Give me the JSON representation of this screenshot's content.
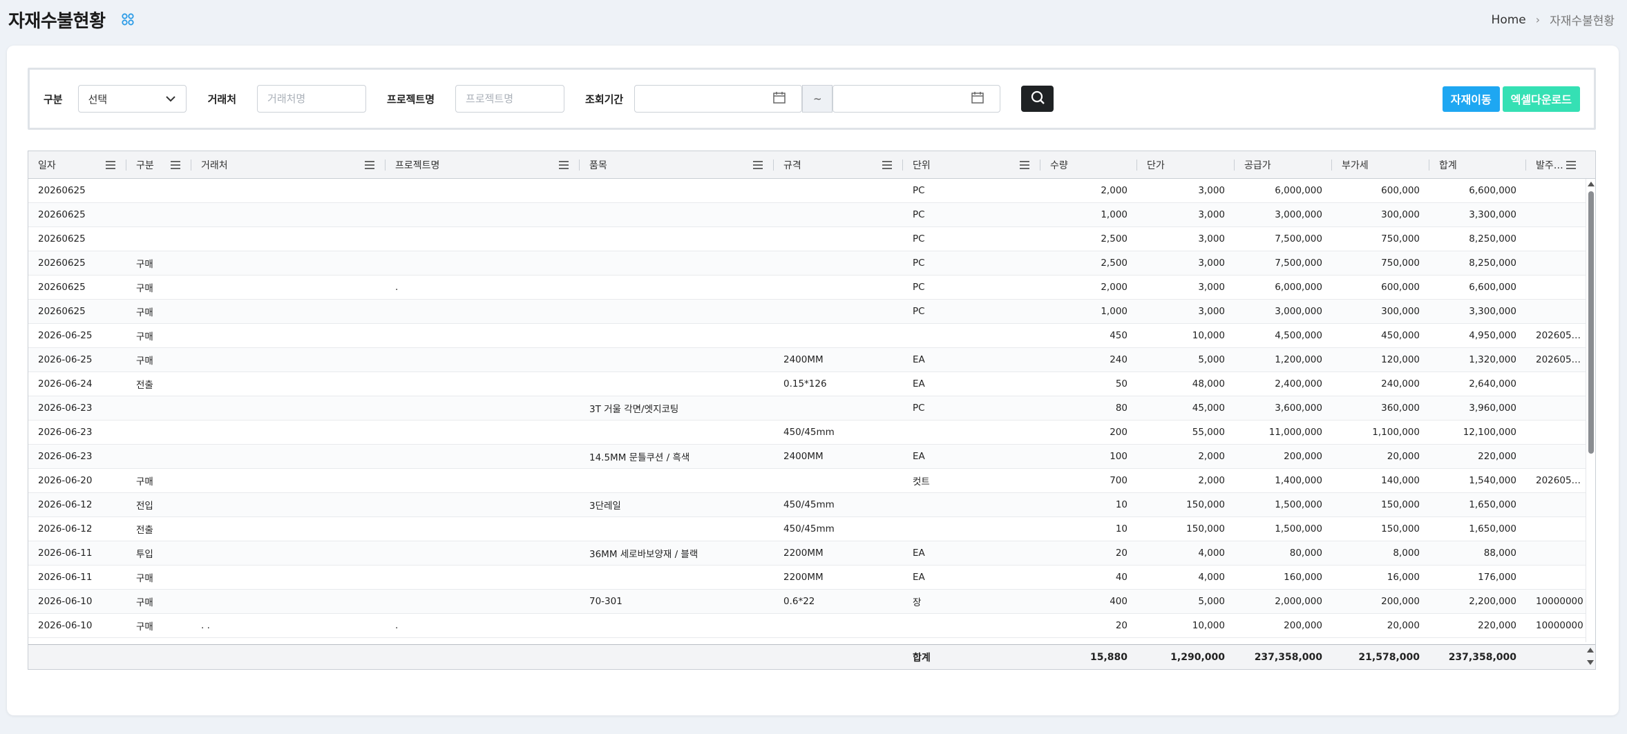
{
  "header": {
    "title": "자재수불현황",
    "breadcrumb": {
      "home": "Home",
      "current": "자재수불현황"
    }
  },
  "filters": {
    "category_label": "구분",
    "category_value": "선택",
    "client_label": "거래처",
    "client_placeholder": "거래처명",
    "project_label": "프로젝트명",
    "project_placeholder": "프로젝트명",
    "period_label": "조회기간",
    "period_separator": "~",
    "move_button": "자재이동",
    "excel_button": "엑셀다운로드"
  },
  "colors": {
    "move_button": "#1ea7f2",
    "excel_button": "#35e0b4",
    "search_button": "#1f2224",
    "title_icon": "#2a9be6"
  },
  "grid": {
    "columns": [
      "일자",
      "구분",
      "거래처",
      "프로젝트명",
      "품목",
      "규격",
      "단위",
      "수량",
      "단가",
      "공급가",
      "부가세",
      "합계",
      "발주…"
    ],
    "rows": [
      [
        "20260625",
        "",
        "",
        "",
        "",
        "",
        "PC",
        "2,000",
        "3,000",
        "6,000,000",
        "600,000",
        "6,600,000",
        ""
      ],
      [
        "20260625",
        "",
        "",
        "",
        "",
        "",
        "PC",
        "1,000",
        "3,000",
        "3,000,000",
        "300,000",
        "3,300,000",
        ""
      ],
      [
        "20260625",
        "",
        "",
        "",
        "",
        "",
        "PC",
        "2,500",
        "3,000",
        "7,500,000",
        "750,000",
        "8,250,000",
        ""
      ],
      [
        "20260625",
        "구매",
        "",
        "",
        "",
        "",
        "PC",
        "2,500",
        "3,000",
        "7,500,000",
        "750,000",
        "8,250,000",
        ""
      ],
      [
        "20260625",
        "구매",
        "",
        ".",
        "",
        "",
        "PC",
        "2,000",
        "3,000",
        "6,000,000",
        "600,000",
        "6,600,000",
        ""
      ],
      [
        "20260625",
        "구매",
        "",
        "",
        "",
        "",
        "PC",
        "1,000",
        "3,000",
        "3,000,000",
        "300,000",
        "3,300,000",
        ""
      ],
      [
        "2026-06-25",
        "구매",
        "",
        "",
        "",
        "",
        "",
        "450",
        "10,000",
        "4,500,000",
        "450,000",
        "4,950,000",
        "202605…"
      ],
      [
        "2026-06-25",
        "구매",
        "",
        "",
        "",
        "2400MM",
        "EA",
        "240",
        "5,000",
        "1,200,000",
        "120,000",
        "1,320,000",
        "202605…"
      ],
      [
        "2026-06-24",
        "전출",
        "",
        "",
        "",
        "0.15*126",
        "EA",
        "50",
        "48,000",
        "2,400,000",
        "240,000",
        "2,640,000",
        ""
      ],
      [
        "2026-06-23",
        "",
        "",
        "",
        "3T 거울 각면/엣지코팅",
        "",
        "PC",
        "80",
        "45,000",
        "3,600,000",
        "360,000",
        "3,960,000",
        ""
      ],
      [
        "2026-06-23",
        "",
        "",
        "",
        "",
        "450/45mm",
        "",
        "200",
        "55,000",
        "11,000,000",
        "1,100,000",
        "12,100,000",
        ""
      ],
      [
        "2026-06-23",
        "",
        "",
        "",
        "14.5MM 문틀쿠션 / 흑색",
        "2400MM",
        "EA",
        "100",
        "2,000",
        "200,000",
        "20,000",
        "220,000",
        ""
      ],
      [
        "2026-06-20",
        "구매",
        "",
        "",
        "",
        "",
        "컷트",
        "700",
        "2,000",
        "1,400,000",
        "140,000",
        "1,540,000",
        "202605…"
      ],
      [
        "2026-06-12",
        "전입",
        "",
        "",
        "3단레일",
        "450/45mm",
        "",
        "10",
        "150,000",
        "1,500,000",
        "150,000",
        "1,650,000",
        ""
      ],
      [
        "2026-06-12",
        "전출",
        "",
        "",
        "",
        "450/45mm",
        "",
        "10",
        "150,000",
        "1,500,000",
        "150,000",
        "1,650,000",
        ""
      ],
      [
        "2026-06-11",
        "투입",
        "",
        "",
        "36MM 세로바보양재 / 블랙",
        "2200MM",
        "EA",
        "20",
        "4,000",
        "80,000",
        "8,000",
        "88,000",
        ""
      ],
      [
        "2026-06-11",
        "구매",
        "",
        "",
        "",
        "2200MM",
        "EA",
        "40",
        "4,000",
        "160,000",
        "16,000",
        "176,000",
        ""
      ],
      [
        "2026-06-10",
        "구매",
        "",
        "",
        "70-301",
        "0.6*22",
        "장",
        "400",
        "5,000",
        "2,000,000",
        "200,000",
        "2,200,000",
        "10000000"
      ],
      [
        "2026-06-10",
        "구매",
        ". .",
        ".",
        "",
        "",
        "",
        "20",
        "10,000",
        "200,000",
        "20,000",
        "220,000",
        "10000000"
      ]
    ],
    "footer": {
      "label": "합계",
      "quantity": "15,880",
      "unit_price": "1,290,000",
      "supply": "237,358,000",
      "vat": "21,578,000",
      "total": "237,358,000"
    }
  }
}
